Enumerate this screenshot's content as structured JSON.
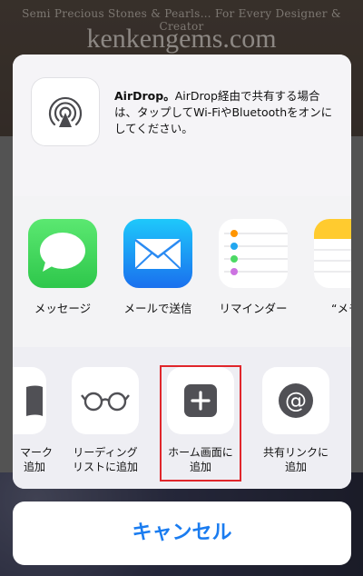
{
  "background": {
    "tagline": "Semi Precious Stones & Pearls… For Every Designer & Creator",
    "logo": "kenkengems.com"
  },
  "airdrop": {
    "icon": "airdrop-icon",
    "title": "AirDrop。",
    "description": "AirDrop経由で共有する場合は、タップしてWi-FiやBluetoothをオンにしてください。"
  },
  "apps": [
    {
      "label": "メッセージ",
      "icon": "messages-icon"
    },
    {
      "label": "メールで送信",
      "icon": "mail-icon"
    },
    {
      "label": "リマインダー",
      "icon": "reminders-icon"
    },
    {
      "label": "“メモ”",
      "icon": "notes-icon"
    }
  ],
  "actions": [
    {
      "label_line1": "マーク",
      "label_line2": "追加",
      "icon": "bookmark-icon"
    },
    {
      "label_line1": "リーディング",
      "label_line2": "リストに追加",
      "icon": "glasses-icon"
    },
    {
      "label_line1": "ホーム画面に",
      "label_line2": "追加",
      "icon": "plus-icon"
    },
    {
      "label_line1": "共有リンクに",
      "label_line2": "追加",
      "icon": "at-icon"
    }
  ],
  "cancel_label": "キャンセル",
  "colors": {
    "accent": "#1a7cf0",
    "highlight": "#e0262b",
    "messages_green": "#3fd05a",
    "mail_blue": "#1f8af4"
  }
}
